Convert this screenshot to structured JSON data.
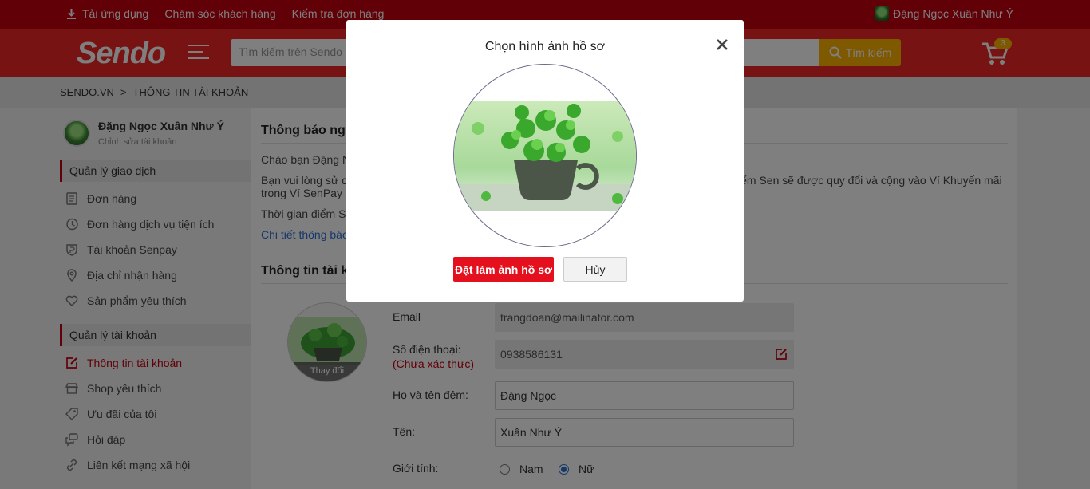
{
  "topbar": {
    "download_app": "Tải ứng dụng",
    "customer_care": "Chăm sóc khách hàng",
    "check_order": "Kiểm tra đơn hàng",
    "user_name": "Đặng Ngọc Xuân Như Ý"
  },
  "header": {
    "logo": "Sendo",
    "search_placeholder": "Tìm kiếm trên Sendo",
    "search_button": "Tìm kiếm",
    "cart_count": "3"
  },
  "breadcrumb": {
    "home": "SENDO.VN",
    "separator": ">",
    "current": "THÔNG TIN TÀI KHOẢN"
  },
  "sidebar": {
    "profile_name": "Đặng Ngọc Xuân Như Ý",
    "edit_account": "Chỉnh sửa tài khoản",
    "section_transactions": "Quản lý giao dịch",
    "items_transactions": [
      {
        "label": "Đơn hàng",
        "icon": "order-icon"
      },
      {
        "label": "Đơn hàng dịch vụ tiện ích",
        "icon": "history-icon"
      },
      {
        "label": "Tài khoản Senpay",
        "icon": "senpay-icon"
      },
      {
        "label": "Địa chỉ nhận hàng",
        "icon": "location-icon"
      },
      {
        "label": "Sản phẩm yêu thích",
        "icon": "heart-icon"
      }
    ],
    "section_account": "Quản lý tài khoản",
    "items_account": [
      {
        "label": "Thông tin tài khoản",
        "icon": "edit-icon"
      },
      {
        "label": "Shop yêu thích",
        "icon": "shop-icon"
      },
      {
        "label": "Ưu đãi của tôi",
        "icon": "tag-icon"
      },
      {
        "label": "Hỏi đáp",
        "icon": "chat-icon"
      },
      {
        "label": "Liên kết mạng xã hội",
        "icon": "link-icon"
      }
    ]
  },
  "main": {
    "notice_title": "Thông báo ngư",
    "notice_greeting": "Chào bạn Đặng N",
    "notice_body_1a": "Bạn vui lòng sử d",
    "notice_body_1b": "iểm Sen sẽ được quy đổi và cộng vào Ví Khuyến mãi",
    "notice_body_2": "trong Ví SenPay l",
    "notice_time": "Thời gian điểm Se",
    "notice_detail_link": "Chi tiết thông báo",
    "account_title": "Thông tin tài kh",
    "avatar_change": "Thay đổi",
    "email_label": "Email",
    "email_value": "trangdoan@mailinator.com",
    "phone_label": "Số điện thoại:",
    "phone_warn": "(Chưa xác thực)",
    "phone_value": "0938586131",
    "middle_name_label": "Họ và tên đệm:",
    "middle_name_value": "Đặng Ngọc",
    "first_name_label": "Tên:",
    "first_name_value": "Xuân Như Ý",
    "gender_label": "Giới tính:",
    "gender_male": "Nam",
    "gender_female": "Nữ"
  },
  "modal": {
    "title": "Chọn hình ảnh hồ sơ",
    "set_button": "Đặt làm ảnh hồ sơ",
    "cancel_button": "Hủy"
  },
  "colors": {
    "brand_red": "#ee2624",
    "dark_red": "#c40010",
    "accent_yellow": "#ffb200",
    "primary_button": "#e5101d"
  }
}
